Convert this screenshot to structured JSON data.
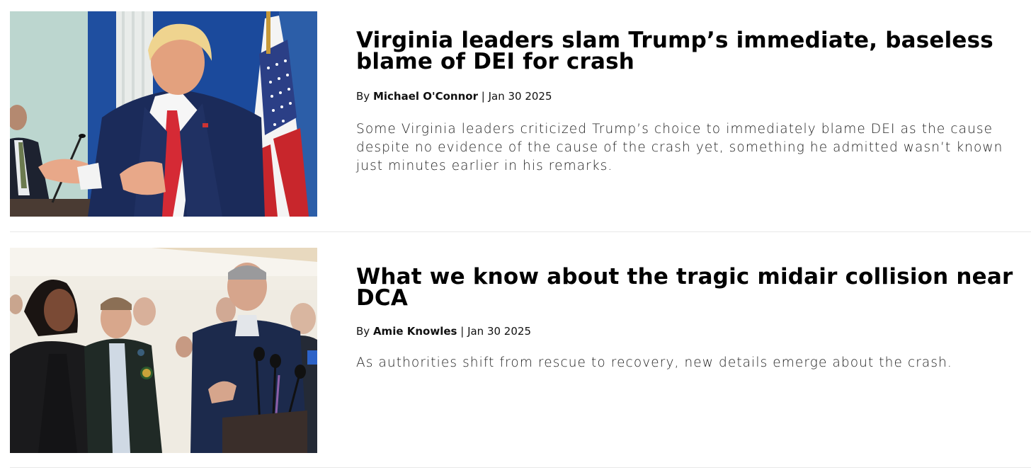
{
  "articles": [
    {
      "headline": "Virginia leaders slam Trump’s immediate, baseless blame of DEI for crash",
      "byline_prefix": "By",
      "author": "Michael O'Connor",
      "separator": "|",
      "date": "Jan 30 2025",
      "summary": "Some Virginia leaders criticized Trump’s choice to immediately blame DEI as the cause despite no evidence of the cause of the crash yet, something he admitted wasn’t known just minutes earlier in his remarks.",
      "image_icon": "press-conference-photo"
    },
    {
      "headline": "What we know about the tragic midair collision near DCA",
      "byline_prefix": "By",
      "author": "Amie Knowles",
      "separator": "|",
      "date": "Jan 30 2025",
      "summary": "As authorities shift from rescue to recovery, new details emerge about the crash.",
      "image_icon": "officials-briefing-photo"
    }
  ],
  "colors": {
    "divider": "#e8e8e8",
    "headline": "#000000",
    "summary": "#222222"
  }
}
